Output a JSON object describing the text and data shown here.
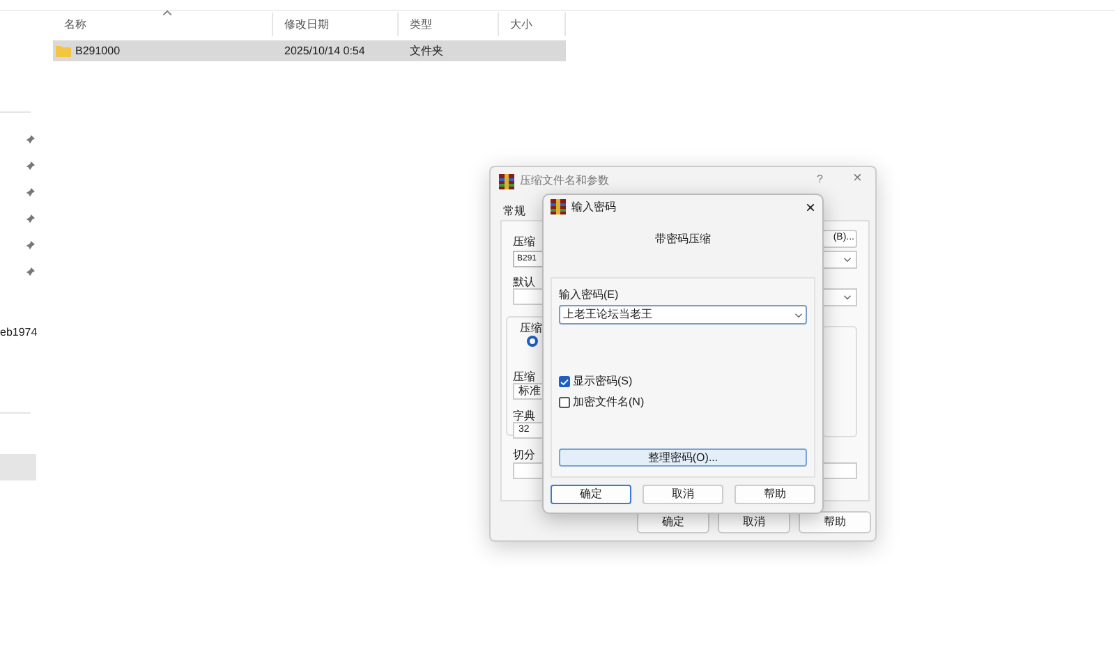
{
  "explorer": {
    "columns": [
      {
        "label": "名称",
        "sorted": true
      },
      {
        "label": "修改日期",
        "sorted": false
      },
      {
        "label": "类型",
        "sorted": false
      },
      {
        "label": "大小",
        "sorted": false
      }
    ],
    "rows": [
      {
        "name": "B291000",
        "modified": "2025/10/14 0:54",
        "type": "文件夹",
        "selected": true
      }
    ]
  },
  "sidebar": {
    "label": "eb1974"
  },
  "back_dialog": {
    "title": "压缩文件名和参数",
    "help": "?",
    "close": "×",
    "tab": "常规",
    "archive_label": "压缩",
    "archive_value": "B291",
    "browse": "(B)...",
    "profile_label": "默认",
    "group_label": "压缩",
    "radio_selected": true,
    "method_label": "压缩",
    "method_value": "标准",
    "dict_label": "字典",
    "dict_value": "32",
    "split_label": "切分",
    "buttons": [
      "确定",
      "取消",
      "帮助"
    ]
  },
  "password_dialog": {
    "title": "输入密码",
    "close": "×",
    "heading": "带密码压缩",
    "field_label": "输入密码(E)",
    "password": "上老王论坛当老王",
    "options": [
      {
        "label": "显示密码(S)",
        "checked": true
      },
      {
        "label": "加密文件名(N)",
        "checked": false
      }
    ],
    "organize": "整理密码(O)...",
    "buttons": [
      {
        "label": "确定",
        "default": true
      },
      {
        "label": "取消",
        "default": false
      },
      {
        "label": "帮助",
        "default": false
      }
    ]
  }
}
